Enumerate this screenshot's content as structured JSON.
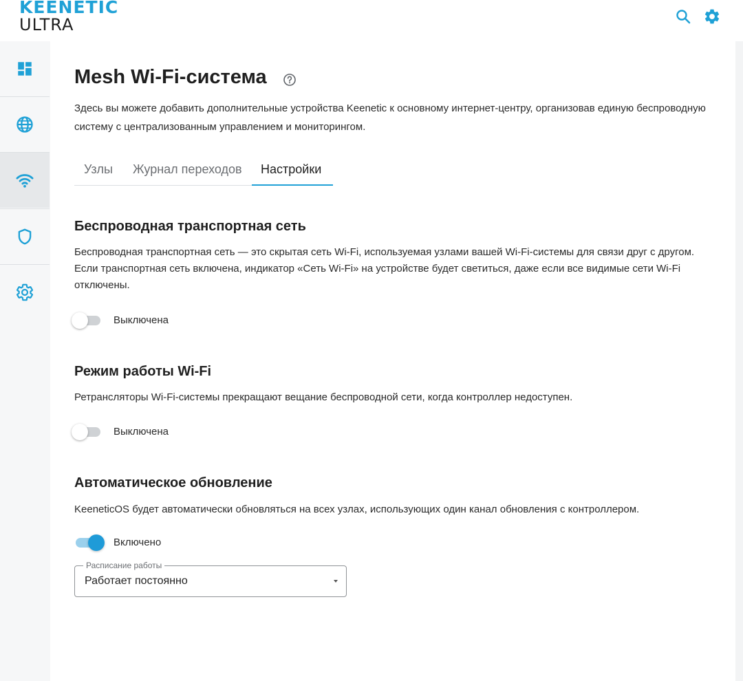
{
  "header": {
    "logo_line1": "KEENETIC",
    "logo_line2": "ULTRA",
    "icons": [
      "search-icon",
      "gear-icon"
    ]
  },
  "sidebar": {
    "items": [
      {
        "icon": "dashboard-icon",
        "active": false
      },
      {
        "icon": "globe-icon",
        "active": false
      },
      {
        "icon": "wifi-icon",
        "active": true
      },
      {
        "icon": "shield-icon",
        "active": false
      },
      {
        "icon": "gear-icon",
        "active": false
      }
    ]
  },
  "page": {
    "title": "Mesh Wi-Fi-система",
    "help_icon": "help-circle-icon",
    "intro": "Здесь вы можете добавить дополнительные устройства Keenetic к основному интернет-центру, организовав единую беспроводную систему с централизованным управлением и мониторингом."
  },
  "tabs": [
    {
      "label": "Узлы",
      "active": false
    },
    {
      "label": "Журнал переходов",
      "active": false
    },
    {
      "label": "Настройки",
      "active": true
    }
  ],
  "sections": {
    "backhaul": {
      "title": "Беспроводная транспортная сеть",
      "description": "Беспроводная транспортная сеть — это скрытая сеть Wi-Fi, используемая узлами вашей Wi-Fi-системы для связи друг с другом. Если транспортная сеть включена, индикатор «Сеть Wi-Fi» на устройстве будет светиться, даже если все видимые сети Wi-Fi отключены.",
      "toggle_on": false,
      "toggle_label": "Выключена"
    },
    "wifi_mode": {
      "title": "Режим работы Wi-Fi",
      "description": "Ретрансляторы Wi-Fi-системы прекращают вещание беспроводной сети, когда контроллер недоступен.",
      "toggle_on": false,
      "toggle_label": "Выключена"
    },
    "auto_update": {
      "title": "Автоматическое обновление",
      "description": "KeeneticOS будет автоматически обновляться на всех узлах, использующих один канал обновления с контроллером.",
      "toggle_on": true,
      "toggle_label": "Включено",
      "schedule_label": "Расписание работы",
      "schedule_value": "Работает постоянно"
    }
  },
  "colors": {
    "accent": "#1fa1d6",
    "text": "#1f1f1f",
    "muted": "#6b6e72"
  }
}
